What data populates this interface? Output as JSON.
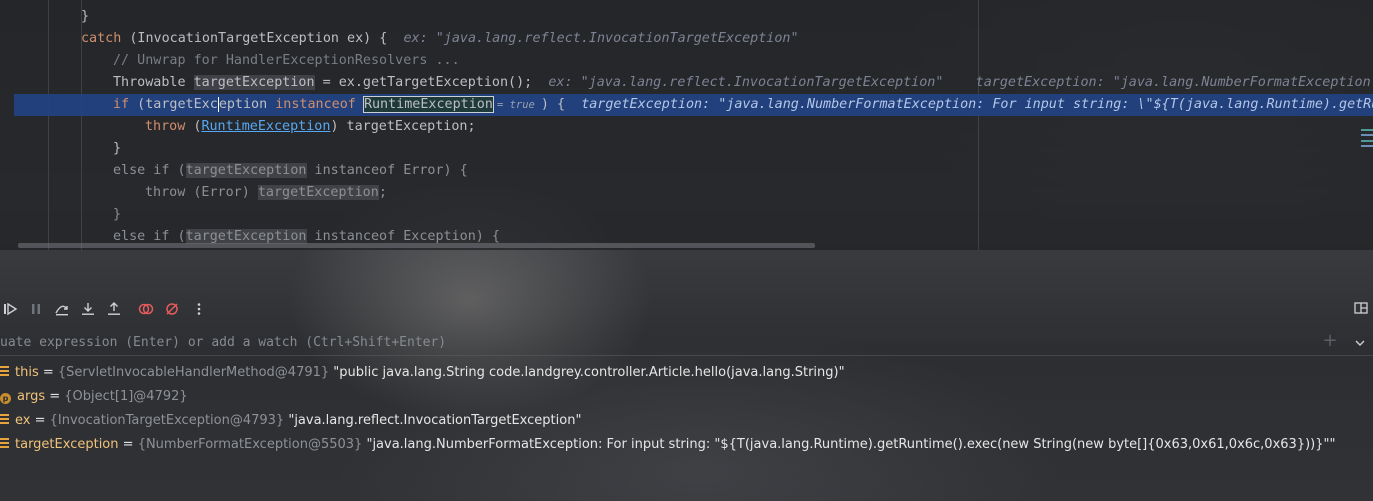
{
  "editor": {
    "lines": [
      {
        "indent": 81,
        "tokens": [
          {
            "t": "}",
            "c": ""
          }
        ]
      },
      {
        "indent": 81,
        "tokens": [
          {
            "t": "catch",
            "c": "kw"
          },
          {
            "t": " (InvocationTargetException ex) {  ",
            "c": ""
          },
          {
            "t": "ex: \"java.lang.reflect.InvocationTargetException\"",
            "c": "hint"
          }
        ]
      },
      {
        "indent": 113,
        "tokens": [
          {
            "t": "// Unwrap for HandlerExceptionResolvers ...",
            "c": "cm"
          }
        ]
      },
      {
        "indent": 113,
        "tokens": [
          {
            "t": "Throwable ",
            "c": ""
          },
          {
            "t": "targetException",
            "c": "shade"
          },
          {
            "t": " = ex.getTargetException();  ",
            "c": ""
          },
          {
            "t": "ex: \"java.lang.reflect.InvocationTargetException\"    targetException: \"java.lang.NumberFormatException: For input string: \\\"${T(java.lang.Runtime).getRuntime().exec(new String(new byte[]{0x63,0x61,0x6c,0x63})\\\"\"",
            "c": "hint"
          }
        ]
      },
      {
        "indent": 113,
        "current": true,
        "tokens": [
          {
            "t": "if",
            "c": "kw"
          },
          {
            "t": " (targetExc",
            "c": ""
          },
          {
            "t": "",
            "c": "caret"
          },
          {
            "t": "eption ",
            "c": ""
          },
          {
            "t": "instanceof",
            "c": "kw"
          },
          {
            "t": " ",
            "c": ""
          },
          {
            "t": "RuntimeException",
            "c": "boxed"
          },
          {
            "t": "= true",
            "c": "inline-val"
          },
          {
            "t": ") {  ",
            "c": ""
          },
          {
            "t": "targetException: \"java.lang.NumberFormatException: For input string: \\\"${T(java.lang.Runtime).getRuntime().exec(new String(new byte[]{0x63,0x61,0x6c,0x63})\\\"\"",
            "c": "hint-cur"
          }
        ]
      },
      {
        "indent": 145,
        "tokens": [
          {
            "t": "throw",
            "c": "kw"
          },
          {
            "t": " (",
            "c": ""
          },
          {
            "t": "RuntimeException",
            "c": "link"
          },
          {
            "t": ") targetException;",
            "c": ""
          }
        ]
      },
      {
        "indent": 113,
        "tokens": [
          {
            "t": "}",
            "c": ""
          }
        ]
      },
      {
        "indent": 113,
        "tokens": [
          {
            "t": "else if",
            "c": "dim"
          },
          {
            "t": " (",
            "c": "dim"
          },
          {
            "t": "targetException",
            "c": "shade dim"
          },
          {
            "t": " instanceof Error) {",
            "c": "dim"
          }
        ]
      },
      {
        "indent": 145,
        "tokens": [
          {
            "t": "throw (Error) ",
            "c": "dim"
          },
          {
            "t": "targetException",
            "c": "shade dim"
          },
          {
            "t": ";",
            "c": "dim"
          }
        ]
      },
      {
        "indent": 113,
        "tokens": [
          {
            "t": "}",
            "c": "dim"
          }
        ]
      },
      {
        "indent": 113,
        "tokens": [
          {
            "t": "else if",
            "c": "dim"
          },
          {
            "t": " (",
            "c": "dim"
          },
          {
            "t": "targetException",
            "c": "shade dim"
          },
          {
            "t": " instanceof Exception) {",
            "c": "dim"
          }
        ]
      }
    ]
  },
  "debugger": {
    "toolbar": [
      {
        "name": "resume-icon",
        "title": "Resume Program"
      },
      {
        "name": "pause-icon",
        "title": "Pause Program"
      },
      {
        "name": "step-over-icon",
        "title": "Step Over"
      },
      {
        "name": "step-into-icon",
        "title": "Step Into"
      },
      {
        "name": "step-out-icon",
        "title": "Step Out"
      },
      {
        "name": "view-breakpoints-icon",
        "title": "View Breakpoints"
      },
      {
        "name": "mute-breakpoints-icon",
        "title": "Mute Breakpoints"
      },
      {
        "name": "more-icon",
        "title": "More"
      }
    ],
    "eval_placeholder": "uate expression (Enter) or add a watch (Ctrl+Shift+Enter)",
    "eval_plus": "+",
    "variables": [
      {
        "kind": "field",
        "name": "this",
        "eq": " = ",
        "type": "{ServletInvocableHandlerMethod@4791}",
        "value": " \"public java.lang.String code.landgrey.controller.Article.hello(java.lang.String)\""
      },
      {
        "kind": "param",
        "name": "args",
        "eq": " = ",
        "type": "{Object[1]@4792}",
        "value": ""
      },
      {
        "kind": "field",
        "name": "ex",
        "eq": " = ",
        "type": "{InvocationTargetException@4793}",
        "value": " \"java.lang.reflect.InvocationTargetException\""
      },
      {
        "kind": "field",
        "name": "targetException",
        "eq": " = ",
        "type": "{NumberFormatException@5503}",
        "value": " \"java.lang.NumberFormatException: For input string: \"${T(java.lang.Runtime).getRuntime().exec(new String(new byte[]{0x63,0x61,0x6c,0x63}))}\"\""
      }
    ]
  },
  "colors": {
    "current_line": "#214283",
    "keyword": "#cf8e6d",
    "variable_name": "#f0c27a",
    "breakpoint": "#e55b5b"
  }
}
